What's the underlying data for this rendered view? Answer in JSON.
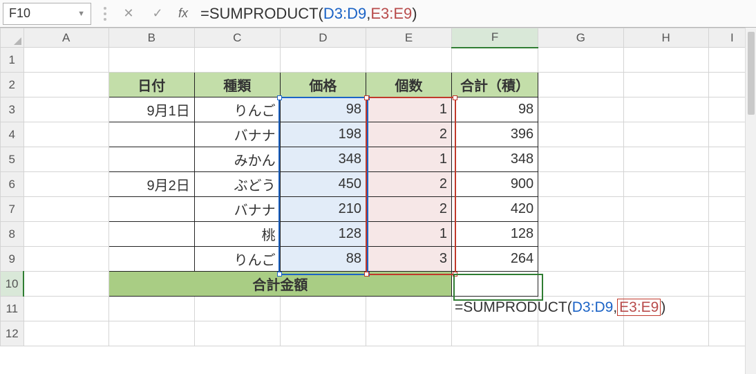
{
  "namebox": "F10",
  "formula_bar": {
    "prefix": "=SUMPRODUCT(",
    "range1": "D3:D9",
    "sep": ",",
    "range2": "E3:E9",
    "suffix": ")"
  },
  "fx_label": "fx",
  "cancel_icon": "✕",
  "enter_icon": "✓",
  "columns": [
    "A",
    "B",
    "C",
    "D",
    "E",
    "F",
    "G",
    "H",
    "I"
  ],
  "rows": [
    "1",
    "2",
    "3",
    "4",
    "5",
    "6",
    "7",
    "8",
    "9",
    "10",
    "11",
    "12"
  ],
  "headers": {
    "b": "日付",
    "c": "種類",
    "d": "価格",
    "e": "個数",
    "f": "合計（積）"
  },
  "data": [
    {
      "b": "9月1日",
      "c": "りんご",
      "d": "98",
      "e": "1",
      "f": "98"
    },
    {
      "b": "",
      "c": "バナナ",
      "d": "198",
      "e": "2",
      "f": "396"
    },
    {
      "b": "",
      "c": "みかん",
      "d": "348",
      "e": "1",
      "f": "348"
    },
    {
      "b": "9月2日",
      "c": "ぶどう",
      "d": "450",
      "e": "2",
      "f": "900"
    },
    {
      "b": "",
      "c": "バナナ",
      "d": "210",
      "e": "2",
      "f": "420"
    },
    {
      "b": "",
      "c": "桃",
      "d": "128",
      "e": "1",
      "f": "128"
    },
    {
      "b": "",
      "c": "りんご",
      "d": "88",
      "e": "3",
      "f": "264"
    }
  ],
  "total_label": "合計金額",
  "cell_formula": {
    "prefix": "=SUMPRODUCT(",
    "range1": "D3:D9",
    "range2": "E3:E9",
    "suffix": ")"
  }
}
